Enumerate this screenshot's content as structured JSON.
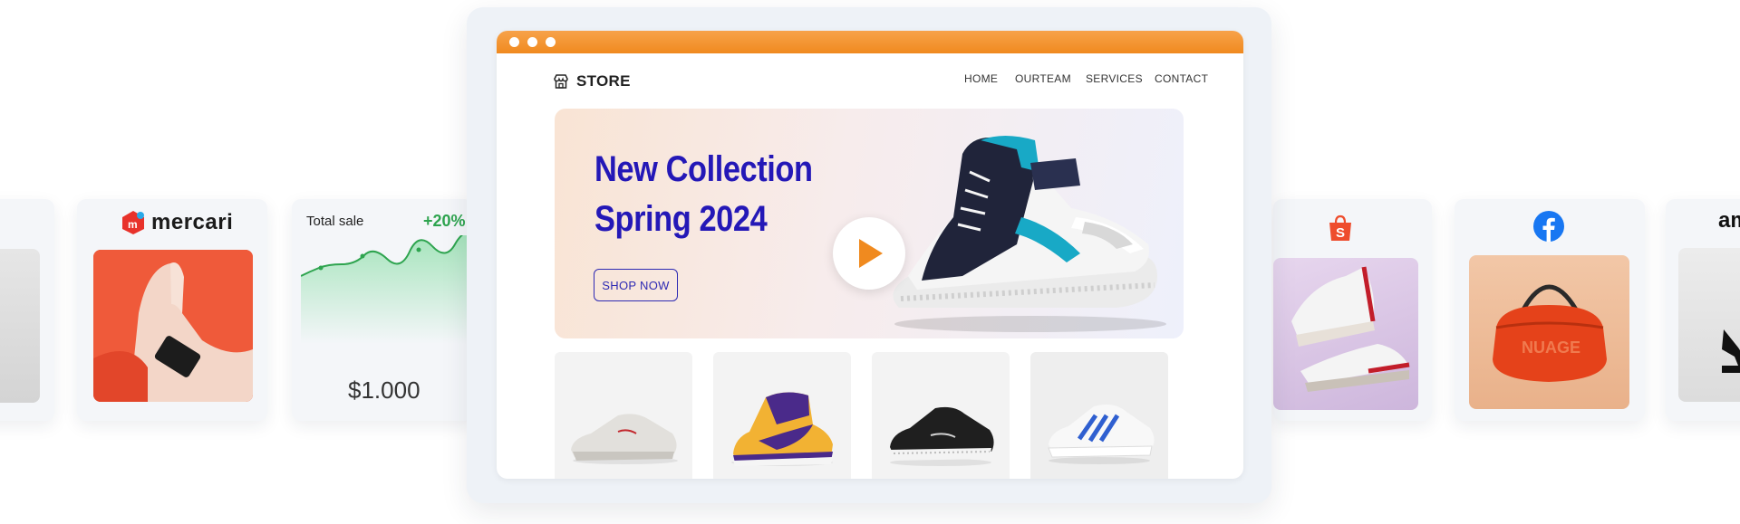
{
  "store": {
    "logo_text": "STORE",
    "nav": [
      "HOME",
      "OURTEAM",
      "SERVICES",
      "CONTACT"
    ],
    "hero": {
      "title_line1": "New Collection",
      "title_line2": "Spring 2024",
      "cta": "SHOP NOW"
    },
    "accent_color": "#f08a1f",
    "title_color": "#2418b7"
  },
  "cards": {
    "mercari": {
      "brand": "mercari"
    },
    "sale": {
      "label": "Total sale",
      "change": "+20%",
      "total": "$1.000"
    },
    "amazon": {
      "brand_fragment": "am"
    }
  },
  "icons": [
    "store-icon",
    "play-icon",
    "mercari-logo-icon",
    "shopee-bag-icon",
    "facebook-icon"
  ]
}
